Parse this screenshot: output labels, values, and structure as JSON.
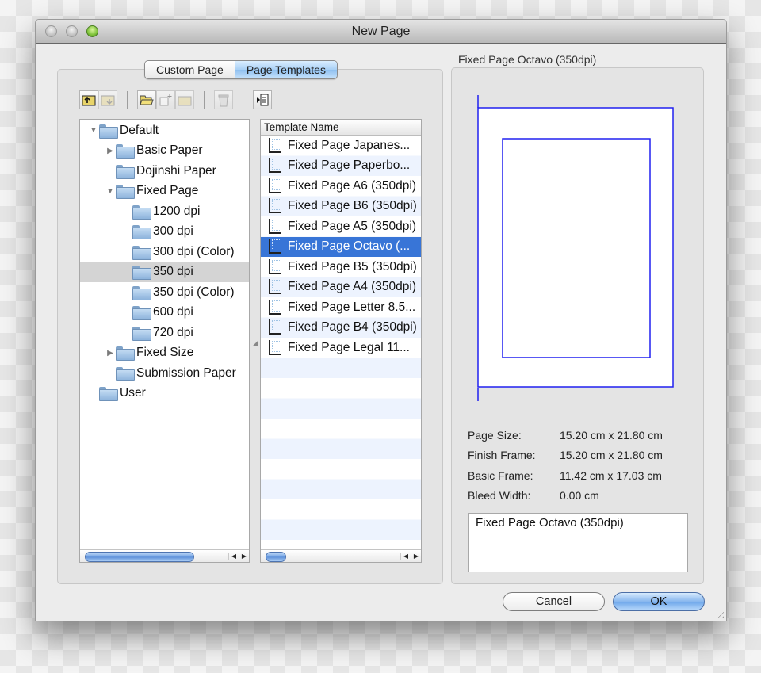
{
  "window": {
    "title": "New Page",
    "controls": [
      "close",
      "minimize",
      "zoom"
    ]
  },
  "tabs": [
    {
      "label": "Custom Page",
      "active": false
    },
    {
      "label": "Page Templates",
      "active": true
    }
  ],
  "toolbar": {
    "buttons": [
      {
        "name": "folder-up-icon",
        "enabled": true
      },
      {
        "name": "folder-move-icon",
        "enabled": false
      },
      {
        "name": "open-folder-icon",
        "enabled": true
      },
      {
        "name": "new-template-icon",
        "enabled": false
      },
      {
        "name": "new-folder-icon",
        "enabled": false
      },
      {
        "name": "trash-icon",
        "enabled": false
      },
      {
        "name": "toggle-list-icon",
        "enabled": true
      }
    ]
  },
  "tree": {
    "items": [
      {
        "label": "Default",
        "level": 0,
        "disclosure": "expanded"
      },
      {
        "label": "Basic Paper",
        "level": 1,
        "disclosure": "collapsed"
      },
      {
        "label": "Dojinshi Paper",
        "level": 1,
        "disclosure": "none"
      },
      {
        "label": "Fixed Page",
        "level": 1,
        "disclosure": "expanded"
      },
      {
        "label": "1200 dpi",
        "level": 2,
        "disclosure": "none"
      },
      {
        "label": "300 dpi",
        "level": 2,
        "disclosure": "none"
      },
      {
        "label": "300 dpi (Color)",
        "level": 2,
        "disclosure": "none"
      },
      {
        "label": "350 dpi",
        "level": 2,
        "disclosure": "none",
        "selected": true
      },
      {
        "label": "350 dpi (Color)",
        "level": 2,
        "disclosure": "none"
      },
      {
        "label": "600 dpi",
        "level": 2,
        "disclosure": "none"
      },
      {
        "label": "720 dpi",
        "level": 2,
        "disclosure": "none"
      },
      {
        "label": "Fixed Size",
        "level": 1,
        "disclosure": "collapsed"
      },
      {
        "label": "Submission Paper",
        "level": 1,
        "disclosure": "none"
      },
      {
        "label": "User",
        "level": 0,
        "disclosure": "none"
      }
    ]
  },
  "templates": {
    "column_header": "Template Name",
    "items": [
      {
        "label": "Fixed Page Japanes..."
      },
      {
        "label": "Fixed Page Paperbo..."
      },
      {
        "label": "Fixed Page A6 (350dpi)"
      },
      {
        "label": "Fixed Page B6 (350dpi)"
      },
      {
        "label": "Fixed Page A5 (350dpi)"
      },
      {
        "label": "Fixed Page Octavo (...",
        "selected": true
      },
      {
        "label": "Fixed Page B5 (350dpi)"
      },
      {
        "label": "Fixed Page A4 (350dpi)"
      },
      {
        "label": "Fixed Page Letter 8.5..."
      },
      {
        "label": "Fixed Page B4 (350dpi)"
      },
      {
        "label": "Fixed Page Legal 11..."
      }
    ]
  },
  "preview": {
    "title": "Fixed Page Octavo (350dpi)",
    "frame_color": "#2020f0",
    "info": [
      {
        "label": "Page Size:",
        "value": "15.20 cm x 21.80 cm"
      },
      {
        "label": "Finish Frame:",
        "value": "15.20 cm x 21.80 cm"
      },
      {
        "label": "Basic Frame:",
        "value": "11.42 cm x 17.03 cm"
      },
      {
        "label": "Bleed Width:",
        "value": "0.00 cm"
      }
    ],
    "description": "Fixed Page Octavo (350dpi)"
  },
  "buttons": {
    "cancel": "Cancel",
    "ok": "OK"
  },
  "colors": {
    "selection": "#3875d7",
    "default_button": "#6da6ea"
  }
}
